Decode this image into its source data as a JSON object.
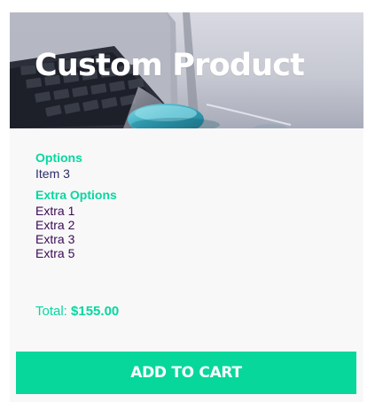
{
  "product": {
    "title": "Custom Product",
    "hero_image": "laptop-photo"
  },
  "sections": {
    "options": {
      "title": "Options",
      "items": [
        "Item 3"
      ]
    },
    "extra_options": {
      "title": "Extra Options",
      "items": [
        "Extra 1",
        "Extra 2",
        "Extra 3",
        "Extra 5"
      ]
    }
  },
  "summary": {
    "total_label": "Total:",
    "total_value": "$155.00"
  },
  "cta": {
    "label": "ADD TO CART"
  },
  "theme": {
    "accent": "#08D7A0",
    "text_primary": "#2D2D6B",
    "text_extra": "#3B0A56",
    "card_bg": "#F8F8F8"
  }
}
